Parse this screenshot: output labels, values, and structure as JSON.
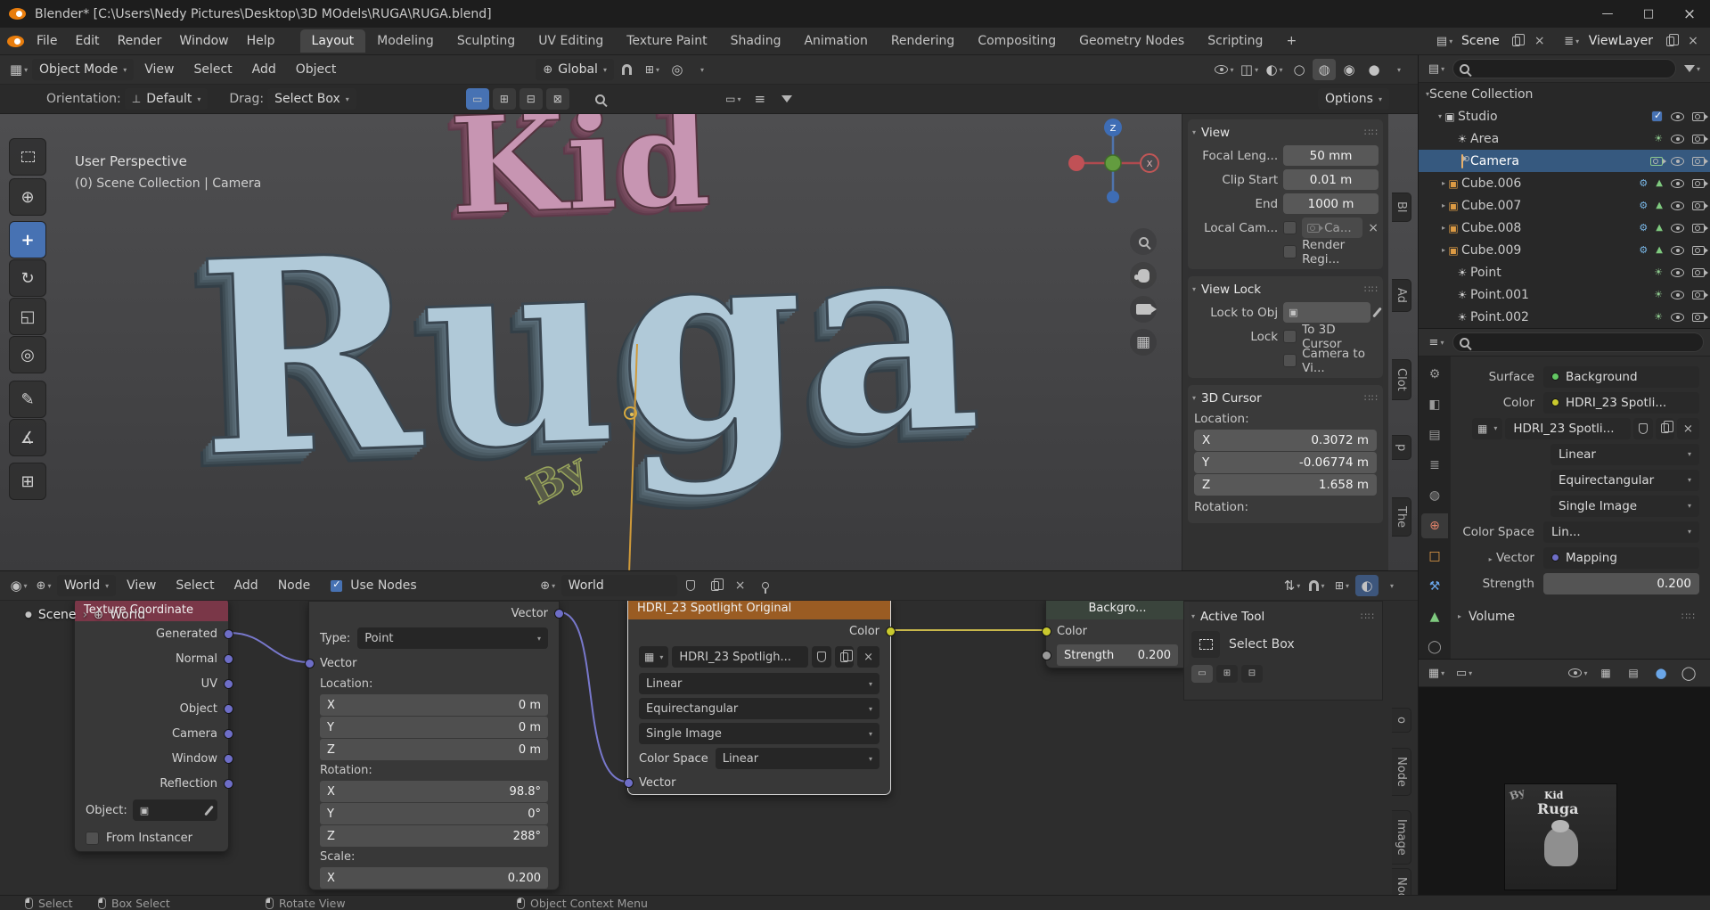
{
  "titlebar": {
    "title": "Blender* [C:\\Users\\Nedy Pictures\\Desktop\\3D MOdels\\RUGA\\RUGA.blend]",
    "minimize": "—",
    "maximize": "□",
    "close": "×"
  },
  "topbar": {
    "menus": [
      "File",
      "Edit",
      "Render",
      "Window",
      "Help"
    ],
    "workspaces": [
      "Layout",
      "Modeling",
      "Sculpting",
      "UV Editing",
      "Texture Paint",
      "Shading",
      "Animation",
      "Rendering",
      "Compositing",
      "Geometry Nodes",
      "Scripting"
    ],
    "add_tab": "+",
    "scene_label": "Scene",
    "view_layer_label": "ViewLayer"
  },
  "viewport": {
    "mode": "Object Mode",
    "menus": [
      "View",
      "Select",
      "Add",
      "Object"
    ],
    "orientation": "Global",
    "tool_row": {
      "orientation_label": "Orientation:",
      "orientation_value": "Default",
      "drag_label": "Drag:",
      "drag_value": "Select Box",
      "options_label": "Options"
    },
    "overlay_line1": "User Perspective",
    "overlay_line2": "(0) Scene Collection | Camera",
    "objects": {
      "kid": "Kid",
      "ruga": "Ruga",
      "by": "By"
    },
    "gizmo": {
      "z": "Z",
      "x": "X"
    },
    "sidebar_tabs": [
      "Bl",
      "Ad",
      "Clot",
      "p",
      "The"
    ]
  },
  "n_panel": {
    "view": {
      "title": "View",
      "rows": [
        [
          "Focal Leng...",
          "50 mm"
        ],
        [
          "Clip Start",
          "0.01 m"
        ],
        [
          "End",
          "1000 m"
        ]
      ],
      "local_cam_label": "Local Cam...",
      "local_cam_value": "Ca...",
      "render_region_label": "Render Regi..."
    },
    "view_lock": {
      "title": "View Lock",
      "lock_obj_label": "Lock to Obj",
      "lock_label": "Lock",
      "cursor_label": "To 3D Cursor",
      "camera_label": "Camera to Vi..."
    },
    "cursor": {
      "title": "3D Cursor",
      "location_label": "Location:",
      "axes": [
        [
          "X",
          "0.3072 m"
        ],
        [
          "Y",
          "-0.06774 m"
        ],
        [
          "Z",
          "1.658 m"
        ]
      ],
      "rotation_label": "Rotation:"
    }
  },
  "outliner": {
    "root": "Scene Collection",
    "collection": "Studio",
    "items": [
      {
        "name": "Area"
      },
      {
        "name": "Camera"
      },
      {
        "name": "Cube.006"
      },
      {
        "name": "Cube.007"
      },
      {
        "name": "Cube.008"
      },
      {
        "name": "Cube.009"
      },
      {
        "name": "Point"
      },
      {
        "name": "Point.001"
      },
      {
        "name": "Point.002"
      }
    ]
  },
  "properties": {
    "surface_label": "Surface",
    "surface_value": "Background",
    "color_label": "Color",
    "color_value": "HDRI_23 Spotli...",
    "image_name": "HDRI_23 Spotli...",
    "interpolation": "Linear",
    "projection": "Equirectangular",
    "source": "Single Image",
    "color_space_label": "Color Space",
    "color_space_value": "Lin...",
    "vector_label": "Vector",
    "vector_value": "Mapping",
    "strength_label": "Strength",
    "strength_value": "0.200",
    "volume_label": "Volume"
  },
  "shader": {
    "type_value": "World",
    "menus": [
      "View",
      "Select",
      "Add",
      "Node"
    ],
    "use_nodes_label": "Use Nodes",
    "datablock": "World",
    "breadcrumb": {
      "scene": "Scene",
      "sep": "›",
      "world": "World"
    },
    "sidebar_tabs": [
      "o",
      "Node",
      "Image",
      "Nod"
    ],
    "active_tool": {
      "title": "Active Tool",
      "tool_label": "Select Box"
    }
  },
  "nodes": {
    "texture_coordinate": {
      "title": "Texture Coordinate",
      "outputs": [
        "Generated",
        "Normal",
        "UV",
        "Object",
        "Camera",
        "Window",
        "Reflection"
      ],
      "object_label": "Object:",
      "from_instancer_label": "From Instancer"
    },
    "mapping": {
      "vector_out": "Vector",
      "type_label": "Type:",
      "type_value": "Point",
      "vector_in": "Vector",
      "location_label": "Location:",
      "location": [
        [
          "X",
          "0 m"
        ],
        [
          "Y",
          "0 m"
        ],
        [
          "Z",
          "0 m"
        ]
      ],
      "rotation_label": "Rotation:",
      "rotation": [
        [
          "X",
          "98.8°"
        ],
        [
          "Y",
          "0°"
        ],
        [
          "Z",
          "288°"
        ]
      ],
      "scale_label": "Scale:",
      "scale": [
        [
          "X",
          "0.200"
        ]
      ]
    },
    "environment_texture": {
      "title": "HDRI_23 Spotlight Original",
      "color_out": "Color",
      "image_name": "HDRI_23 Spotligh...",
      "interpolation": "Linear",
      "projection": "Equirectangular",
      "source": "Single Image",
      "color_space_label": "Color Space",
      "color_space_value": "Linear",
      "vector_in": "Vector"
    },
    "background": {
      "title": "Backgro...",
      "color_in": "Color",
      "strength_label": "Strength",
      "strength_value": "0.200"
    }
  },
  "image_editor": {
    "preview": {
      "kid": "Kid",
      "ruga": "Ruga",
      "by": "By"
    }
  },
  "statusbar": {
    "items": [
      "Select",
      "Box Select",
      "Rotate View",
      "Object Context Menu"
    ]
  },
  "colors": {
    "accent": "#4772b3",
    "selection": "#36597f",
    "socket_vector": "#6e6ec7",
    "socket_color": "#c9c92e",
    "header_texture_node": "#9a5c23",
    "header_input_node": "#7a3748",
    "kid_text": "#c795b2",
    "ruga_text": "#b0c9d8"
  }
}
